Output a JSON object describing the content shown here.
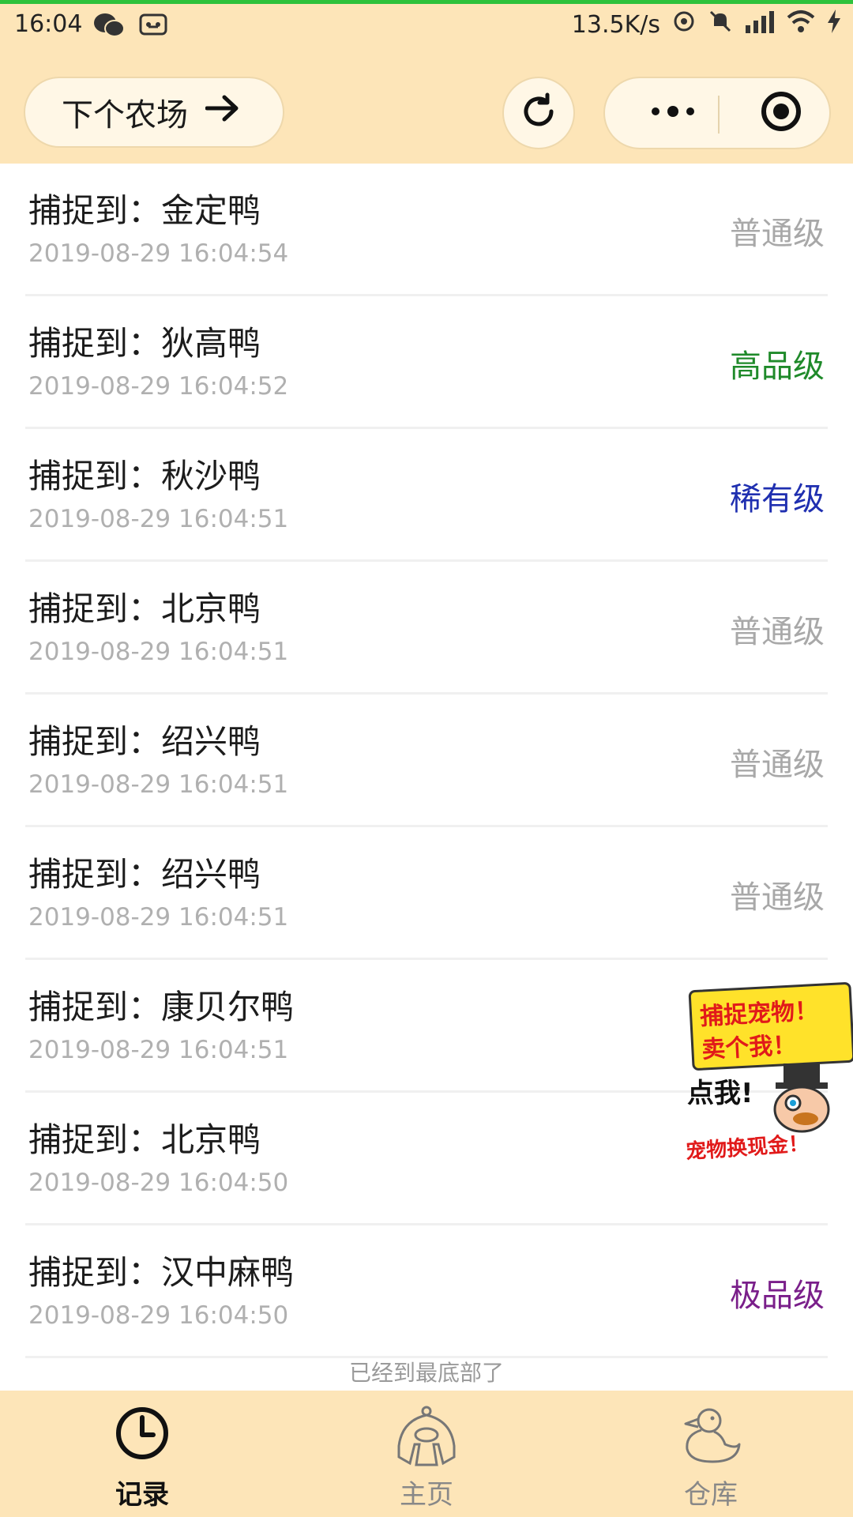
{
  "status_bar": {
    "time": "16:04",
    "net_speed": "13.5K/s",
    "icons": [
      "wechat-icon",
      "voicemail-icon",
      "sync-icon",
      "mute-icon",
      "signal-icon",
      "wifi-icon",
      "charging-icon"
    ]
  },
  "header": {
    "next_farm_label": "下个农场"
  },
  "records": [
    {
      "title": "捕捉到：金定鸭",
      "time": "2019-08-29 16:04:54",
      "grade": "普通级",
      "grade_color": "#a8a8a8"
    },
    {
      "title": "捕捉到：狄高鸭",
      "time": "2019-08-29 16:04:52",
      "grade": "高品级",
      "grade_color": "#1f8a2a"
    },
    {
      "title": "捕捉到：秋沙鸭",
      "time": "2019-08-29 16:04:51",
      "grade": "稀有级",
      "grade_color": "#1f2fb0"
    },
    {
      "title": "捕捉到：北京鸭",
      "time": "2019-08-29 16:04:51",
      "grade": "普通级",
      "grade_color": "#a8a8a8"
    },
    {
      "title": "捕捉到：绍兴鸭",
      "time": "2019-08-29 16:04:51",
      "grade": "普通级",
      "grade_color": "#a8a8a8"
    },
    {
      "title": "捕捉到：绍兴鸭",
      "time": "2019-08-29 16:04:51",
      "grade": "普通级",
      "grade_color": "#a8a8a8"
    },
    {
      "title": "捕捉到：康贝尔鸭",
      "time": "2019-08-29 16:04:51",
      "grade": "",
      "grade_color": "#a8a8a8"
    },
    {
      "title": "捕捉到：北京鸭",
      "time": "2019-08-29 16:04:50",
      "grade": "",
      "grade_color": "#a8a8a8"
    },
    {
      "title": "捕捉到：汉中麻鸭",
      "time": "2019-08-29 16:04:50",
      "grade": "极品级",
      "grade_color": "#7a1f8a"
    }
  ],
  "ad": {
    "line1": "捕捉宠物！",
    "line2": "卖个我！",
    "click": "点我!",
    "cash": "宠物换现金！"
  },
  "footer_message": "已经到最底部了",
  "tabbar": {
    "tabs": [
      {
        "label": "记录",
        "icon": "clock-icon",
        "active": true
      },
      {
        "label": "主页",
        "icon": "home-icon",
        "active": false
      },
      {
        "label": "仓库",
        "icon": "duck-icon",
        "active": false
      }
    ]
  }
}
